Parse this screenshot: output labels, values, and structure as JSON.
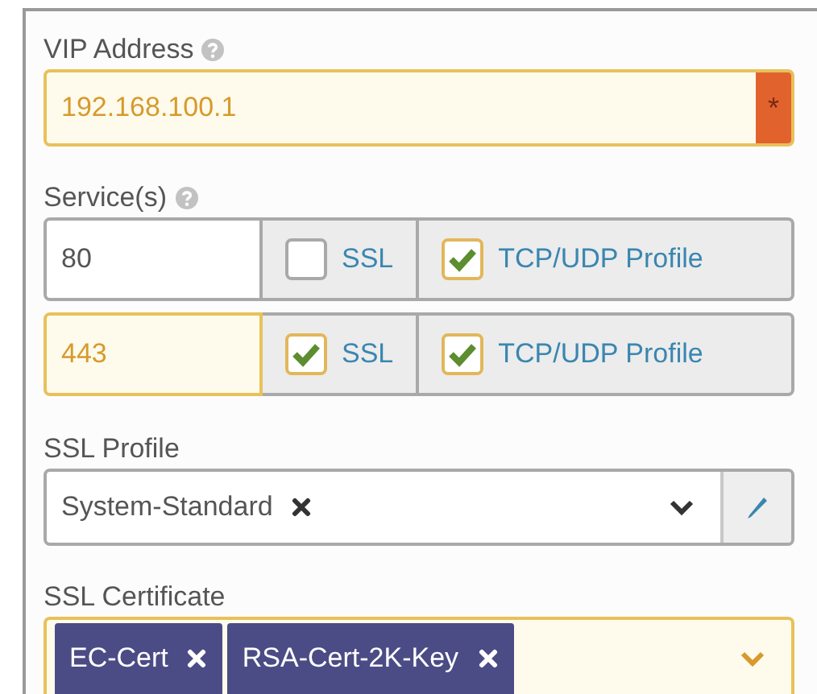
{
  "vip_address": {
    "label": "VIP Address",
    "value": "192.168.100.1",
    "required_mark": "*",
    "highlighted": true
  },
  "services": {
    "label": "Service(s)",
    "rows": [
      {
        "port": "80",
        "highlighted": false,
        "options": [
          {
            "label": "SSL",
            "checked": false
          },
          {
            "label": "TCP/UDP Profile",
            "checked": true
          }
        ]
      },
      {
        "port": "443",
        "highlighted": true,
        "options": [
          {
            "label": "SSL",
            "checked": true
          },
          {
            "label": "TCP/UDP Profile",
            "checked": true
          }
        ]
      }
    ]
  },
  "ssl_profile": {
    "label": "SSL Profile",
    "value": "System-Standard"
  },
  "ssl_certificate": {
    "label": "SSL Certificate",
    "highlighted": true,
    "tags": [
      "EC-Cert",
      "RSA-Cert-2K-Key"
    ]
  }
}
